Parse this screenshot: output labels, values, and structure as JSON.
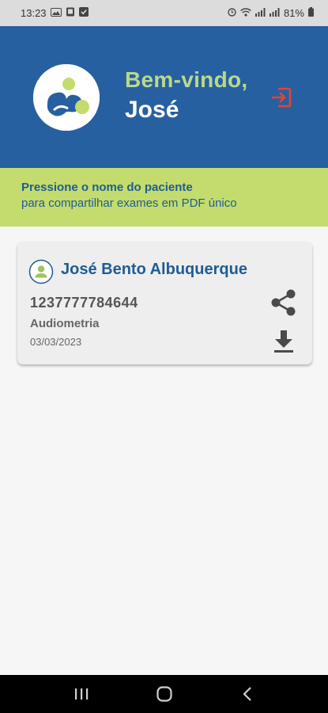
{
  "status_bar": {
    "time": "13:23",
    "battery": "81%",
    "left_icons": [
      "gallery-icon",
      "tablet-icon",
      "check-icon"
    ],
    "right_icons": [
      "alarm-icon",
      "wifi-icon",
      "signal-icon",
      "signal-icon",
      "battery-icon"
    ]
  },
  "header": {
    "greeting": "Bem-vindo,",
    "username": "José",
    "logout_icon": "logout-icon",
    "colors": {
      "background": "#2760a0",
      "greeting": "#b9d98b",
      "logout": "#e0443a"
    }
  },
  "banner": {
    "title": "Pressione o nome do paciente",
    "subtitle": "para compartilhar exames em PDF único",
    "color": "#c3dc6d"
  },
  "exam_card": {
    "patient_name": "José Bento Albuquerque",
    "exam_id": "1237777784644",
    "exam_type": "Audiometria",
    "exam_date": "03/03/2023",
    "actions": [
      "share-icon",
      "download-icon"
    ]
  },
  "nav_bar": {
    "buttons": [
      "recent-apps-icon",
      "home-icon",
      "back-icon"
    ]
  }
}
